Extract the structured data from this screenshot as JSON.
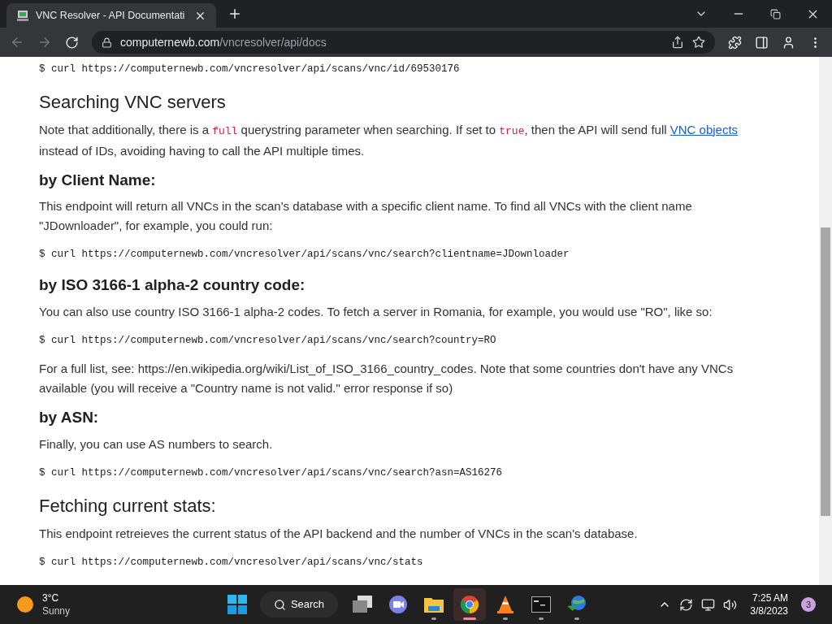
{
  "browser": {
    "tab": {
      "title": "VNC Resolver - API Documentati"
    },
    "address": {
      "host": "computernewb.com",
      "path": "/vncresolver/api/docs"
    }
  },
  "doc": [
    {
      "kind": "code",
      "text": "$ curl https://computernewb.com/vncresolver/api/scans/vnc/id/69530176"
    },
    {
      "kind": "h2",
      "text": "Searching VNC servers"
    },
    {
      "kind": "p",
      "segments": [
        {
          "kind": "text",
          "text": "Note that additionally, there is a "
        },
        {
          "kind": "code",
          "text": "full"
        },
        {
          "kind": "text",
          "text": " querystring parameter when searching. If set to "
        },
        {
          "kind": "code",
          "text": "true"
        },
        {
          "kind": "text",
          "text": ", then the API will send full "
        },
        {
          "kind": "link",
          "text": "VNC objects"
        },
        {
          "kind": "text",
          "text": " instead of IDs, avoiding having to call the API multiple times."
        }
      ]
    },
    {
      "kind": "h3",
      "text": "by Client Name:"
    },
    {
      "kind": "p",
      "segments": [
        {
          "kind": "text",
          "text": "This endpoint will return all VNCs in the scan's database with a specific client name. To find all VNCs with the client name \"JDownloader\", for example, you could run:"
        }
      ]
    },
    {
      "kind": "code",
      "text": "$ curl https://computernewb.com/vncresolver/api/scans/vnc/search?clientname=JDownloader"
    },
    {
      "kind": "h3",
      "text": "by ISO 3166-1 alpha-2 country code:"
    },
    {
      "kind": "p",
      "segments": [
        {
          "kind": "text",
          "text": "You can also use country ISO 3166-1 alpha-2 codes. To fetch a server in Romania, for example, you would use \"RO\", like so:"
        }
      ]
    },
    {
      "kind": "code",
      "text": "$ curl https://computernewb.com/vncresolver/api/scans/vnc/search?country=RO"
    },
    {
      "kind": "p",
      "segments": [
        {
          "kind": "text",
          "text": "For a full list, see: https://en.wikipedia.org/wiki/List_of_ISO_3166_country_codes. Note that some countries don't have any VNCs available (you will receive a \"Country name is not valid.\" error response if so)"
        }
      ]
    },
    {
      "kind": "h3",
      "text": "by ASN:"
    },
    {
      "kind": "p",
      "segments": [
        {
          "kind": "text",
          "text": "Finally, you can use AS numbers to search."
        }
      ]
    },
    {
      "kind": "code",
      "text": "$ curl https://computernewb.com/vncresolver/api/scans/vnc/search?asn=AS16276"
    },
    {
      "kind": "h2",
      "text": "Fetching current stats:"
    },
    {
      "kind": "p",
      "segments": [
        {
          "kind": "text",
          "text": "This endpoint retreieves the current status of the API backend and the number of VNCs in the scan's database."
        }
      ]
    },
    {
      "kind": "code",
      "text": "$ curl https://computernewb.com/vncresolver/api/scans/vnc/stats"
    }
  ],
  "taskbar": {
    "weather": {
      "temp": "3°C",
      "condition": "Sunny"
    },
    "search": "Search",
    "apps": [
      {
        "kind": "taskview",
        "active": false,
        "running": false
      },
      {
        "kind": "chat",
        "active": false,
        "running": false
      },
      {
        "kind": "folder",
        "active": false,
        "running": true
      },
      {
        "kind": "chrome",
        "active": true,
        "running": true
      },
      {
        "kind": "cone",
        "active": false,
        "running": true
      },
      {
        "kind": "terminal",
        "active": false,
        "running": true
      },
      {
        "kind": "globe",
        "active": false,
        "running": true
      }
    ],
    "time": "7:25 AM",
    "date": "3/8/2023",
    "badge": "3"
  }
}
